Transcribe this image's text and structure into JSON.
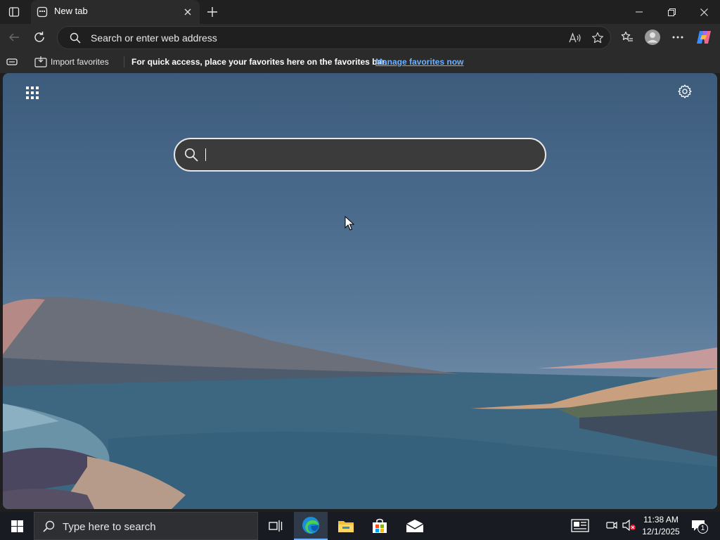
{
  "browser": {
    "tab": {
      "title": "New tab"
    },
    "address_bar": {
      "placeholder": "Search or enter web address"
    },
    "favorites_bar": {
      "import_label": "Import favorites",
      "message": "For quick access, place your favorites here on the favorites bar.",
      "manage_link": "Manage favorites now"
    }
  },
  "new_tab_page": {
    "search": {
      "value": ""
    }
  },
  "taskbar": {
    "search_placeholder": "Type here to search",
    "pinned_apps": [
      "task-view-icon",
      "edge-icon",
      "file-explorer-icon",
      "microsoft-store-icon",
      "mail-icon"
    ],
    "clock": {
      "time": "11:38 AM",
      "date": "12/1/2025"
    },
    "notification_count": "1"
  },
  "colors": {
    "accent_link": "#6fb1ff",
    "titlebar_bg": "#202020",
    "toolbar_bg": "#2b2b2b",
    "taskbar_bg": "#181c22"
  }
}
